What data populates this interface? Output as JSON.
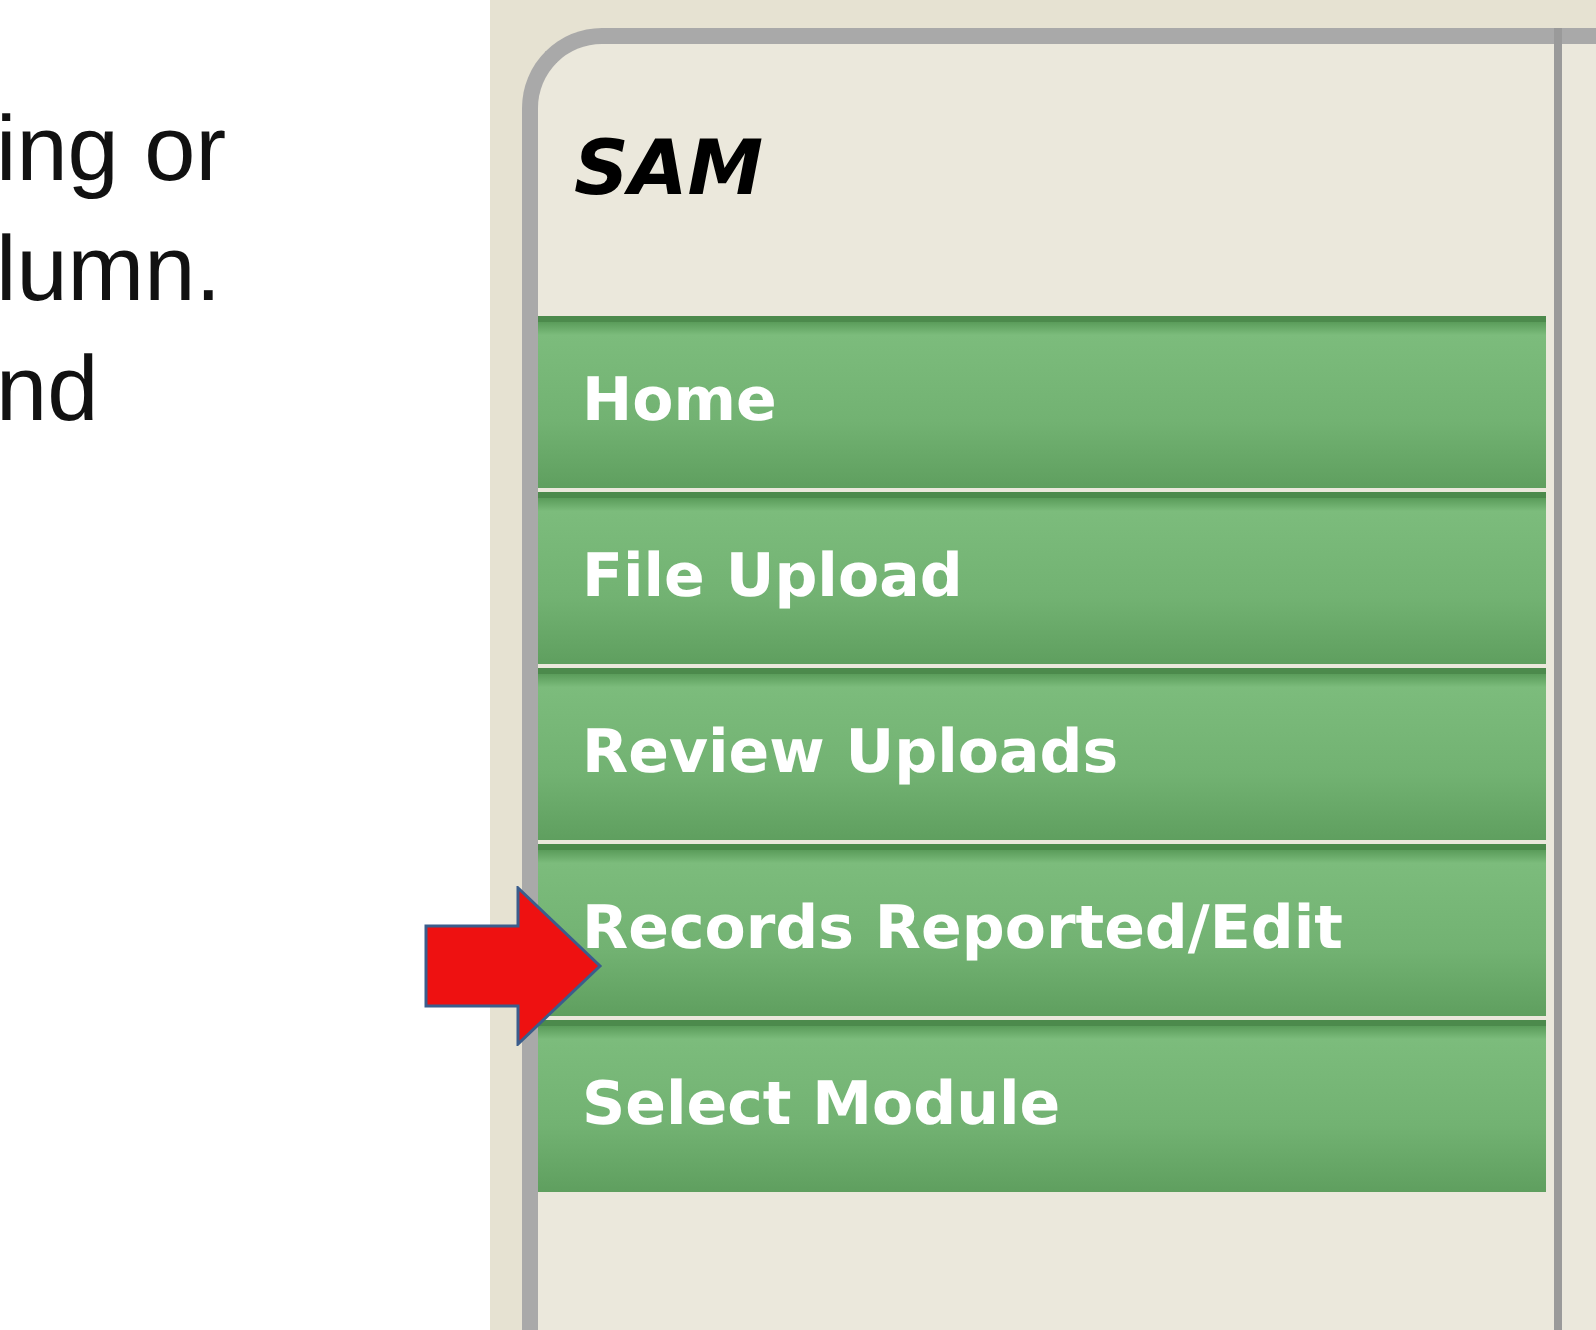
{
  "slide_text": [
    "ing or",
    "lumn.",
    "nd"
  ],
  "app": {
    "title": "SAM",
    "menu": [
      {
        "label": "Home"
      },
      {
        "label": "File Upload"
      },
      {
        "label": "Review Uploads"
      },
      {
        "label": "Records Reported/Edit"
      },
      {
        "label": "Select Module"
      }
    ]
  }
}
